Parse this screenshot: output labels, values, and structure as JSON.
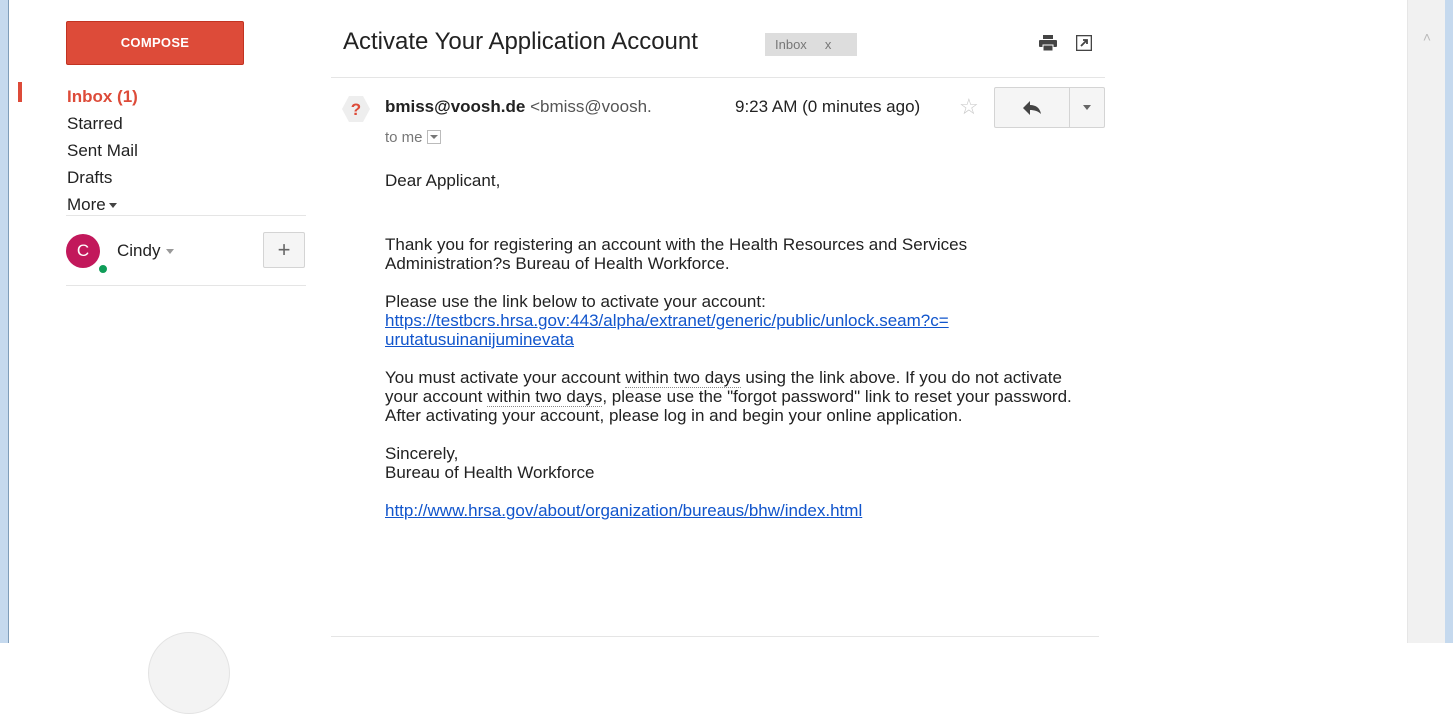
{
  "sidebar": {
    "compose_label": "COMPOSE",
    "items": [
      {
        "label": "Inbox (1)"
      },
      {
        "label": "Starred"
      },
      {
        "label": "Sent Mail"
      },
      {
        "label": "Drafts"
      },
      {
        "label": "More"
      }
    ],
    "hangouts": {
      "avatar_letter": "C",
      "user_name": "Cindy",
      "add_label": "+"
    }
  },
  "email": {
    "subject": "Activate Your Application Account",
    "label": "Inbox",
    "label_remove": "x",
    "sender_avatar": "?",
    "sender_name": "bmiss@voosh.de",
    "sender_email": "<bmiss@voosh.",
    "time": "9:23 AM (0 minutes ago)",
    "recipient": "to me",
    "body": {
      "greeting": "Dear Applicant,",
      "para1": "Thank you for registering an account with the Health Resources and Services Administration?s Bureau of Health Workforce.",
      "para2_intro": "Please use the link below to activate your account:",
      "activation_link_line1": "https://testbcrs.hrsa.gov:443/alpha/extranet/generic/public/unlock.seam?c=",
      "activation_link_line2": "urutatusuinanijuminevata",
      "para3_a": "You must activate your account ",
      "para3_b": "within two days",
      "para3_c": " using the link above. If you do not activate your account ",
      "para3_d": "within two days",
      "para3_e": ", please use the \"forgot password\" link to reset your password. After activating your account, please log in and begin your online application.",
      "closing": "Sincerely,",
      "signature": "Bureau of Health Workforce",
      "footer_link": "http://www.hrsa.gov/about/organization/bureaus/bhw/index.html"
    }
  },
  "icons": {
    "print": "print-icon",
    "new_window": "new-window-icon",
    "star": "star-icon",
    "reply": "reply-icon",
    "more": "chevron-down-icon"
  },
  "colors": {
    "compose": "#dd4b39",
    "active_nav": "#dd4b39",
    "link": "#1155cc",
    "avatar": "#c2185b",
    "online": "#0f9d58",
    "sender_avatar": "#dd4b39"
  }
}
